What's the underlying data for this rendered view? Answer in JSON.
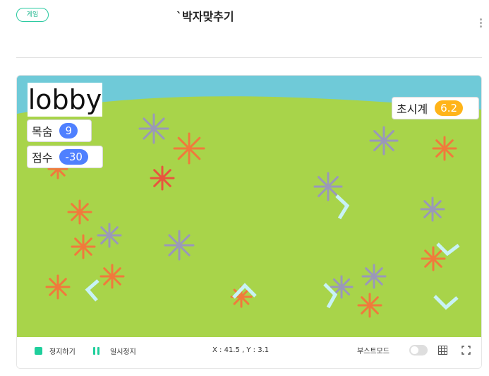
{
  "header": {
    "category_badge": "게임",
    "project_title": "`박자맞추기",
    "more_icon": "more-vertical-icon"
  },
  "stage": {
    "lobby_label": "lobby",
    "variables": {
      "lives": {
        "name": "목숨",
        "value": "9"
      },
      "score": {
        "name": "점수",
        "value": "-30"
      },
      "timer": {
        "name": "초시계",
        "value": "6.2"
      }
    },
    "colors": {
      "sky": "#6fcad8",
      "grass": "#a8d44a",
      "flower_gray": "#9a98b9",
      "flower_orange": "#f07a3c",
      "flower_red": "#e8553e",
      "arrow": "#c8f2f6",
      "variable_blue": "#4f80ff",
      "variable_orange": "#ffb419",
      "accent_green": "#1fcf9c"
    },
    "sprites": {
      "flowers": "asterisk-flower-sprites",
      "arrows": "chevron-arrow-sprites"
    }
  },
  "controls": {
    "stop_label": "정지하기",
    "pause_label": "일시정지",
    "coordinates": "X : 41.5 , Y : 3.1",
    "boost_label": "부스트모드",
    "boost_enabled": false,
    "grid_icon": "grid-icon",
    "fullscreen_icon": "fullscreen-icon"
  }
}
